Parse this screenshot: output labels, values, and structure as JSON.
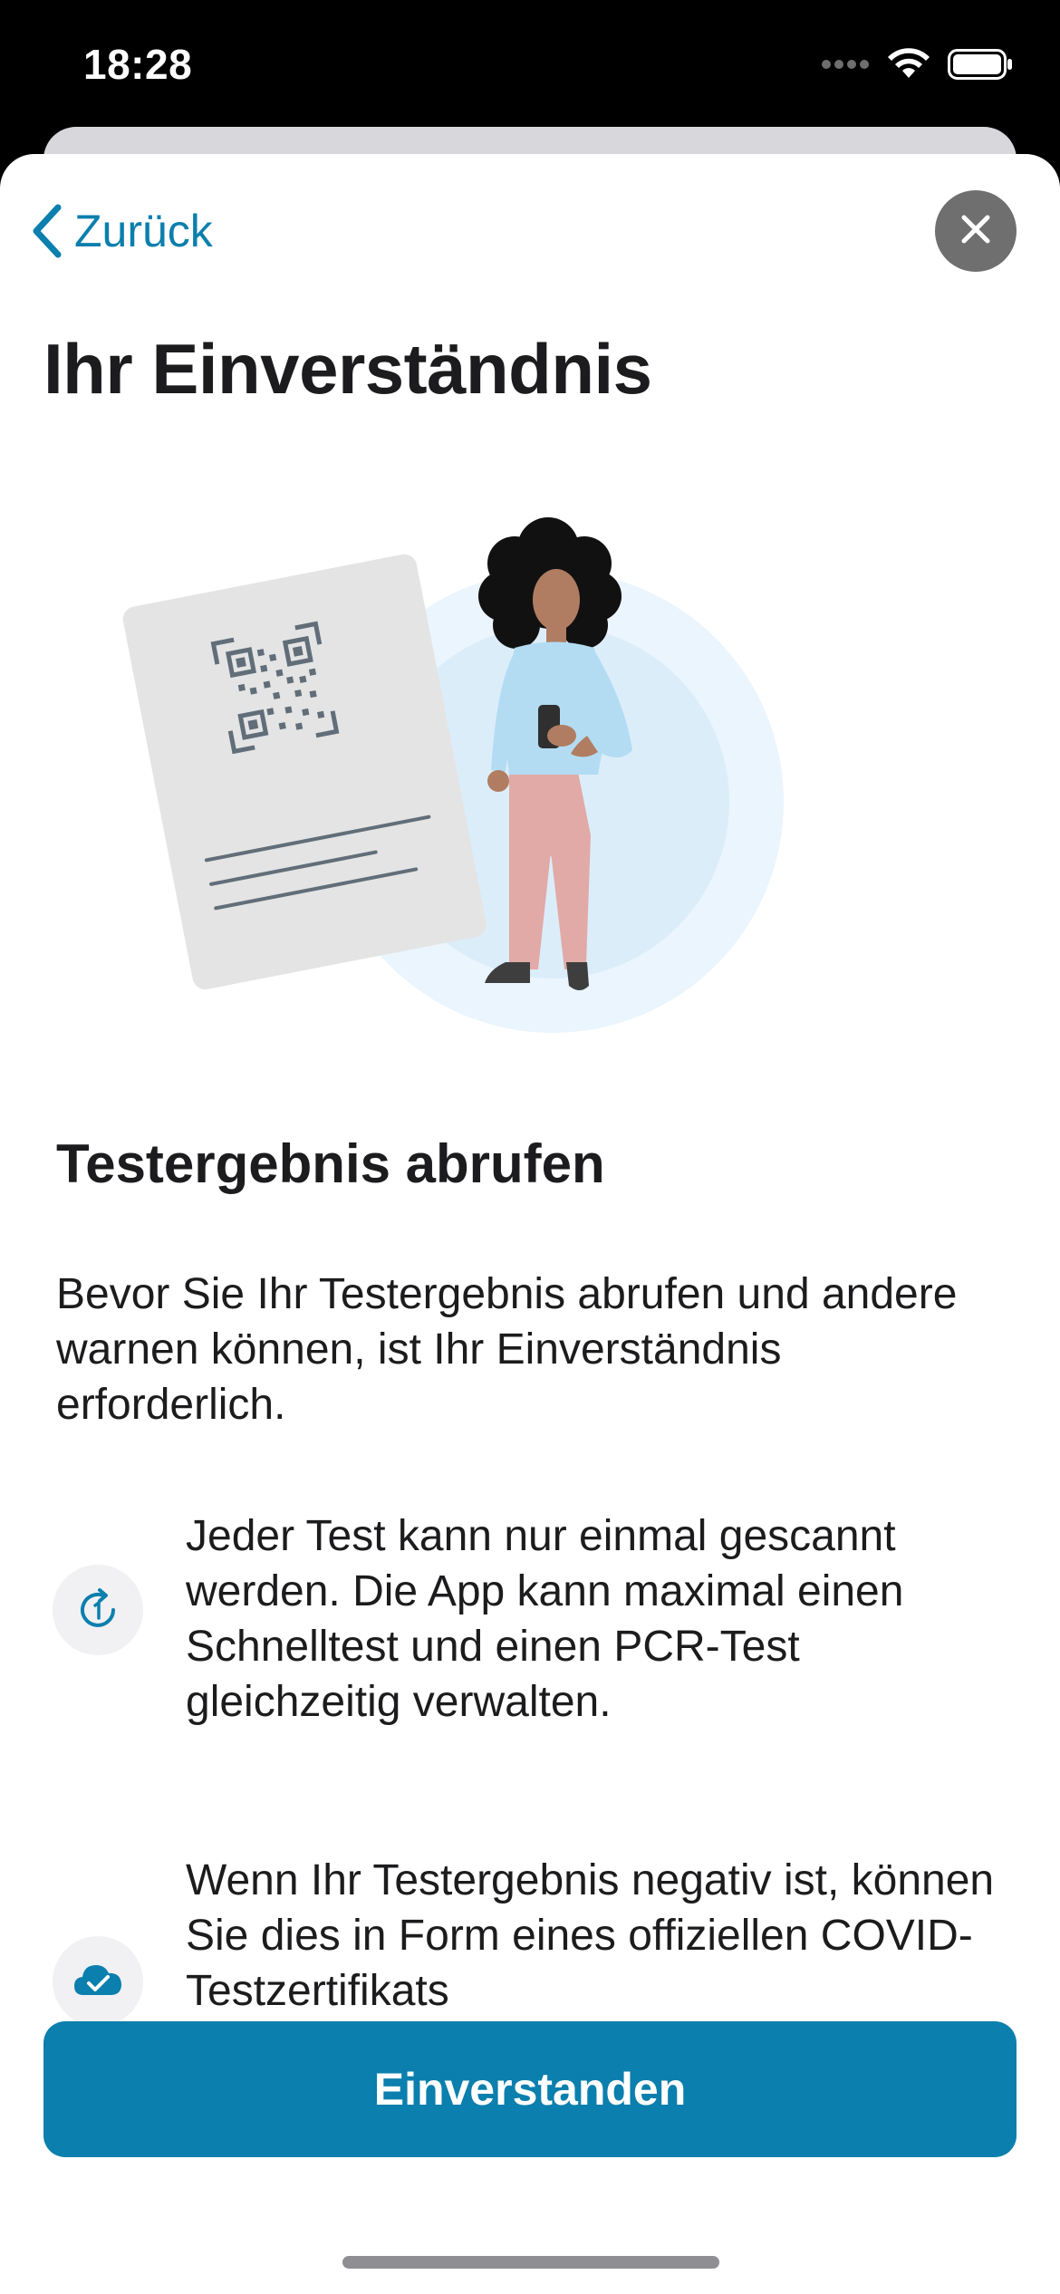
{
  "status_bar": {
    "time": "18:28",
    "icons": [
      "cellular-dots-icon",
      "wifi-icon",
      "battery-icon"
    ]
  },
  "nav": {
    "back_label": "Zurück",
    "back_icon": "chevron-left-icon",
    "close_icon": "close-icon"
  },
  "page_title": "Ihr Einverständnis",
  "illustration": "woman-with-phone-and-qr-code-illustration",
  "section": {
    "title": "Testergebnis abrufen",
    "intro": "Bevor Sie Ihr Testergebnis abrufen und andere warnen können, ist Ihr Einverständnis erforderlich."
  },
  "bullets": [
    {
      "icon": "one-time-scan-icon",
      "text": "Jeder Test kann nur einmal gescannt werden. Die App kann maximal einen Schnelltest und einen PCR-Test gleichzeitig verwalten."
    },
    {
      "icon": "cloud-check-icon",
      "text": "Wenn Ihr Testergebnis negativ ist, können Sie dies in Form eines offiziellen COVID-Testzertifikats"
    }
  ],
  "primary_button": {
    "label": "Einverstanden"
  },
  "colors": {
    "accent": "#0b7fad",
    "close_button": "#6f6f6f",
    "title_text": "#1c1c1e"
  }
}
